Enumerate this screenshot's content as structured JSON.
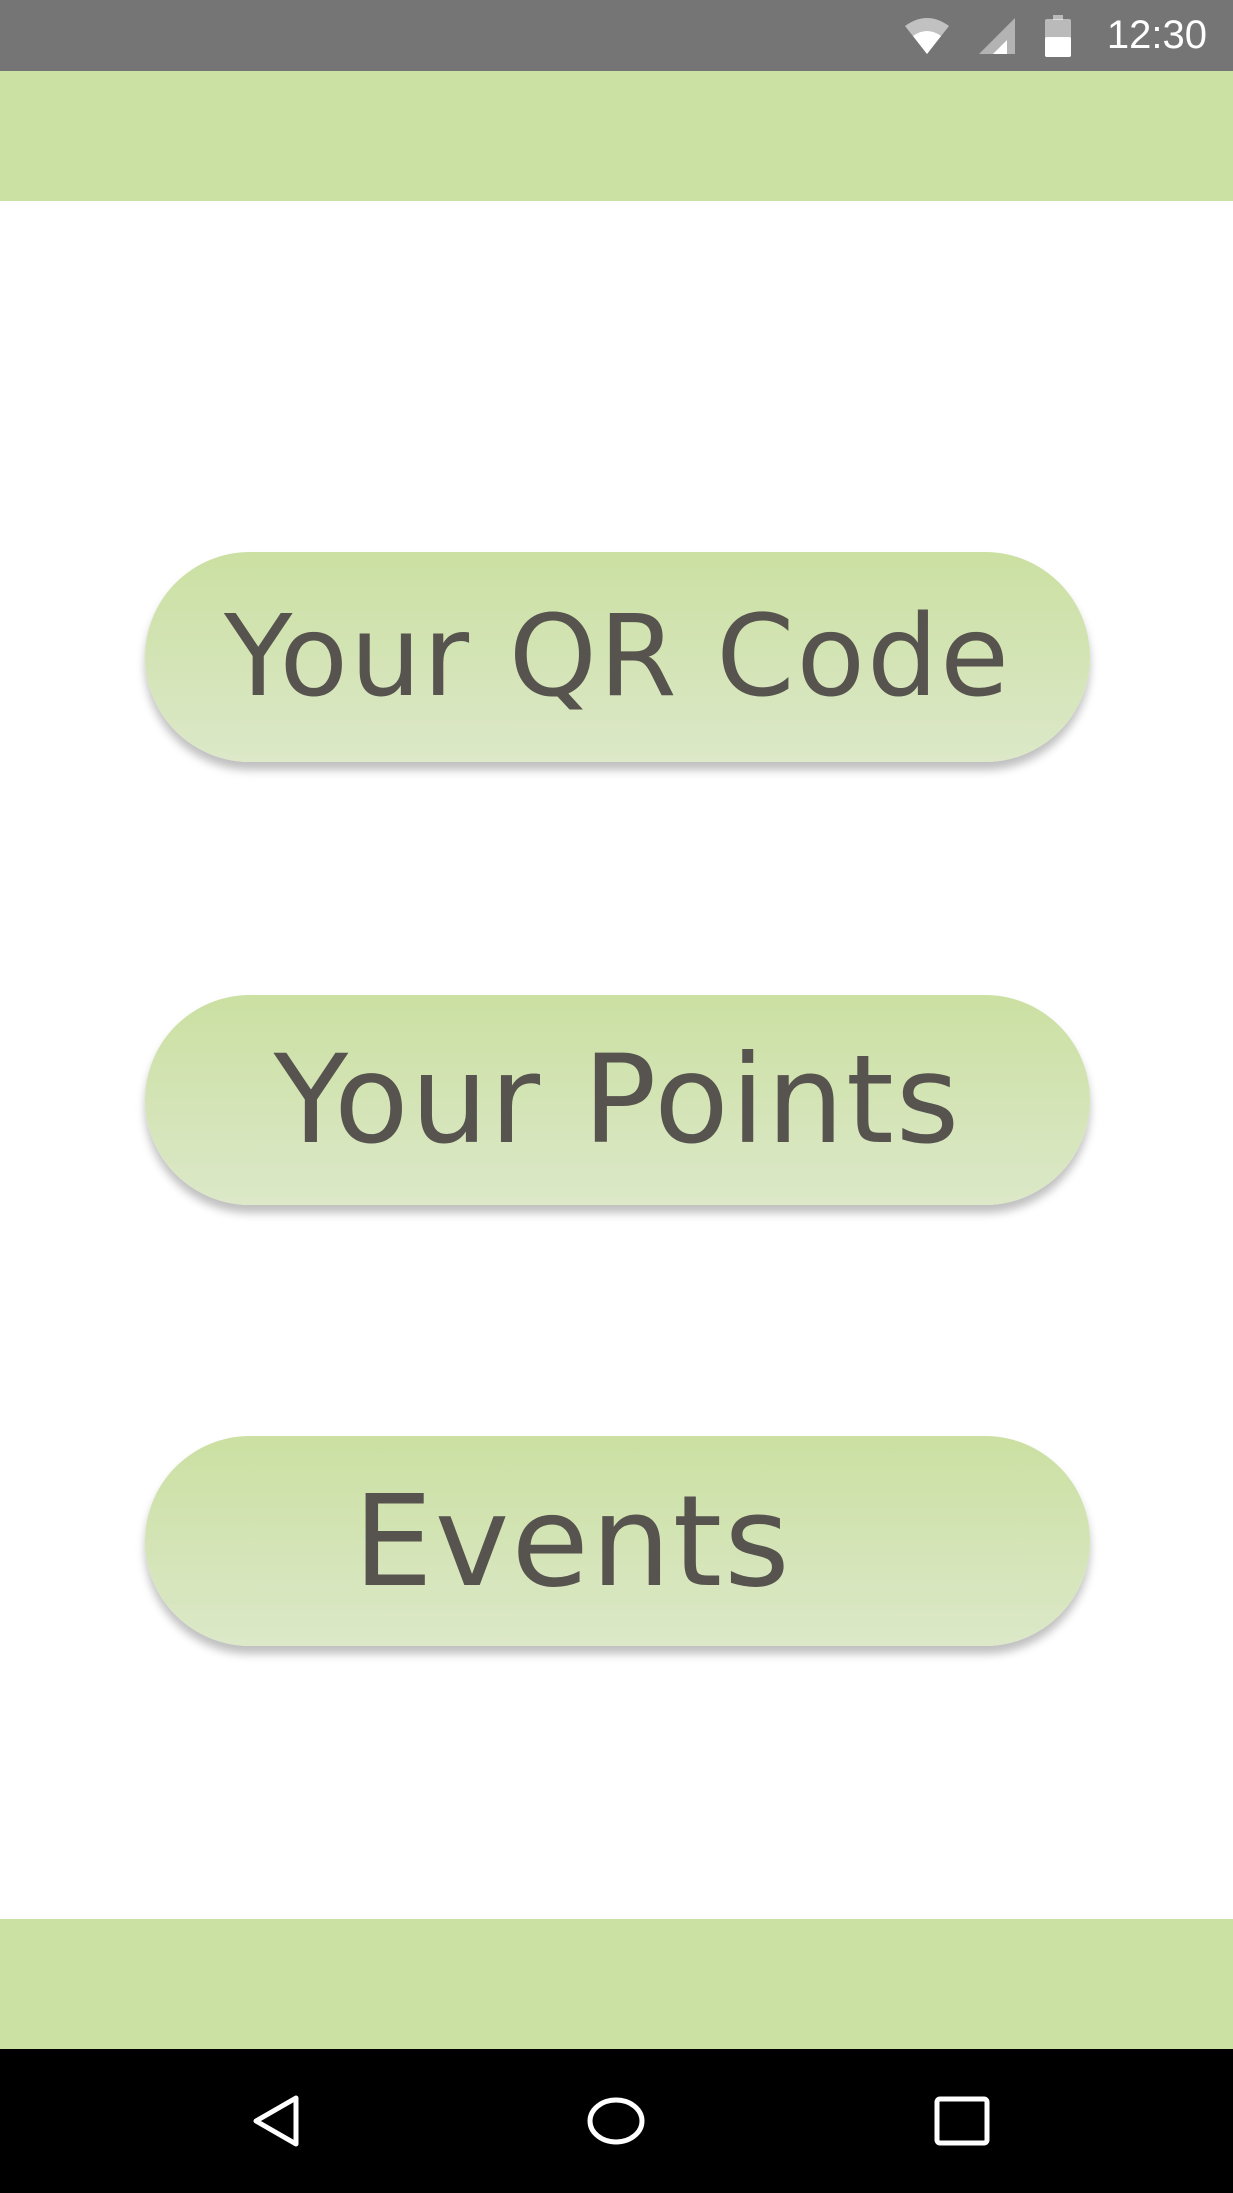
{
  "status_bar": {
    "time": "12:30",
    "icons": [
      "wifi-icon",
      "cellular-signal-icon",
      "battery-icon"
    ],
    "background": "#757575"
  },
  "app": {
    "accent": "#cbe1a4",
    "button_text_color": "#57534e"
  },
  "menu": {
    "qr_code_label": "Your QR Code",
    "points_label": "Your Points",
    "events_label": "Events"
  },
  "nav_bar": {
    "icons": [
      "back-icon",
      "home-icon",
      "recents-icon"
    ]
  }
}
